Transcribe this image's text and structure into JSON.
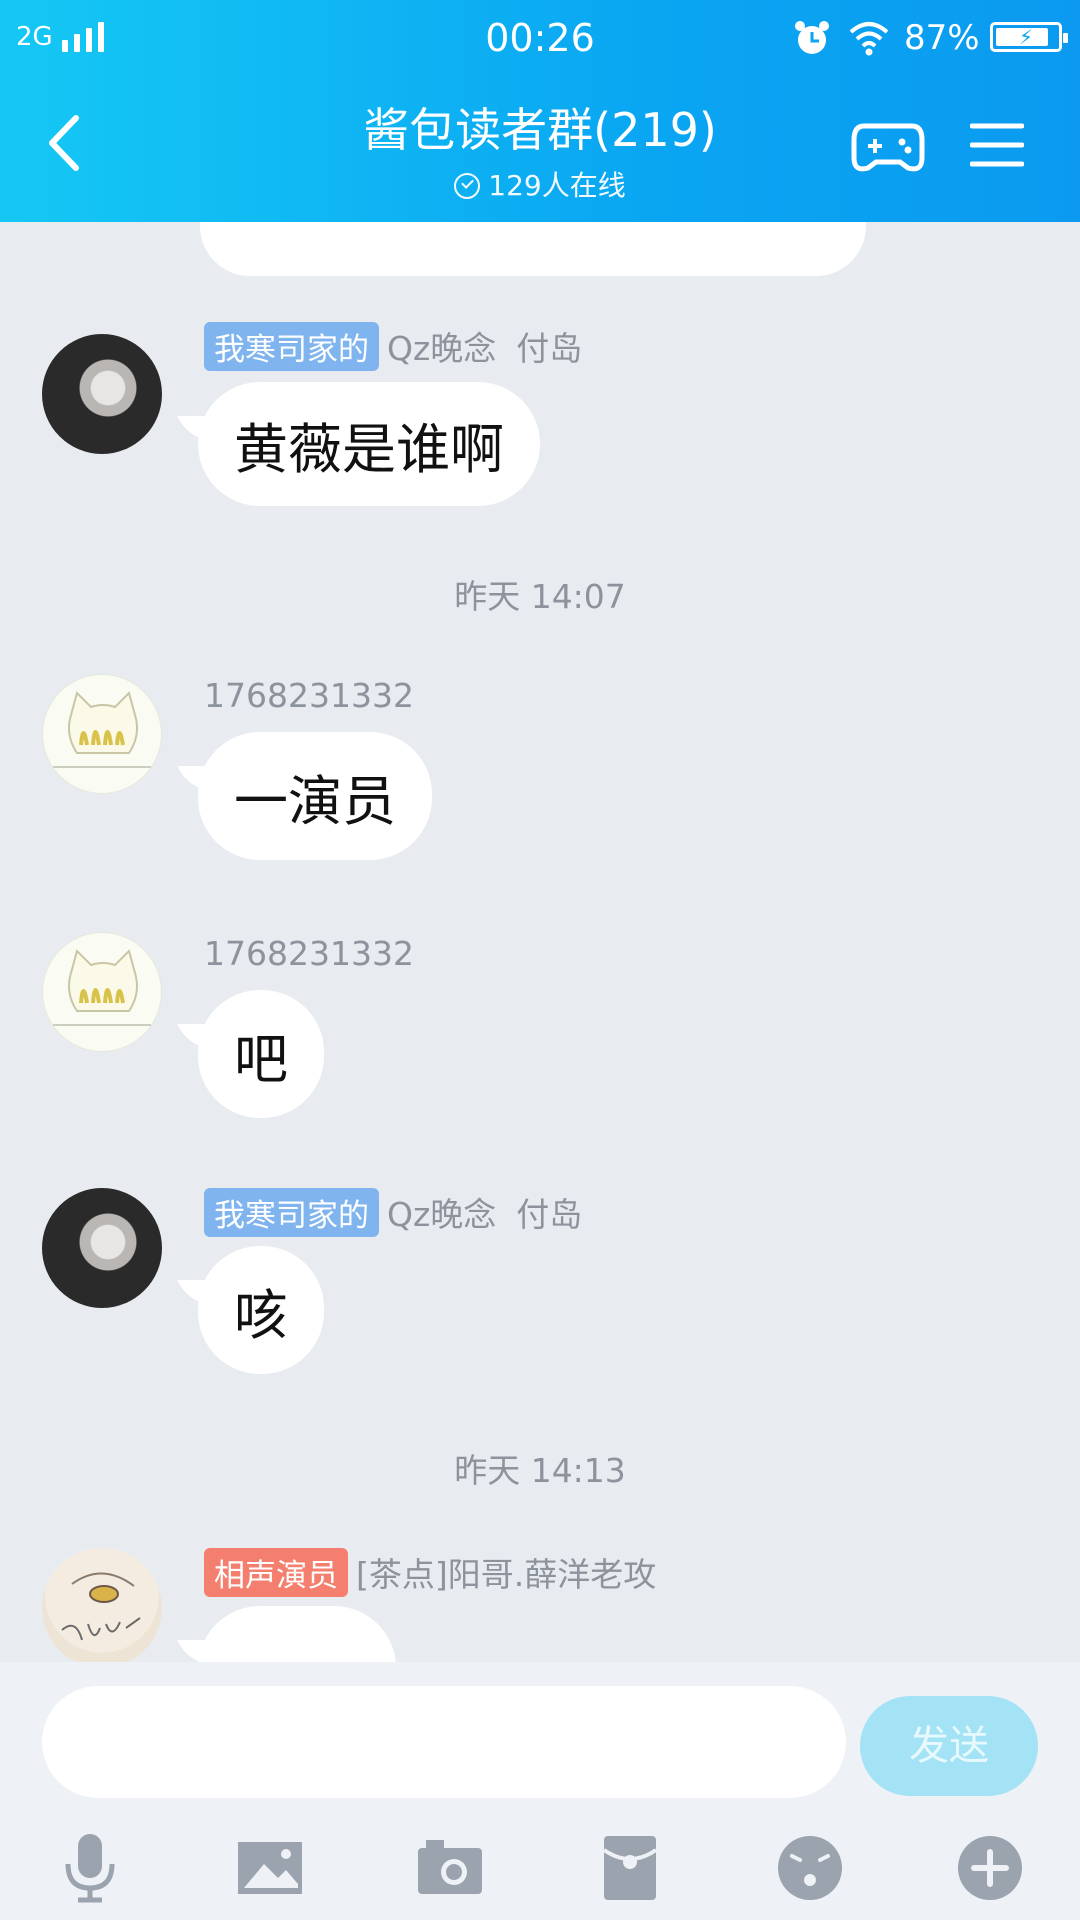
{
  "status_bar": {
    "network": "2G",
    "time": "00:26",
    "battery": "87%",
    "battery_level": 0.87
  },
  "header": {
    "title": "酱包读者群(219)",
    "online": "129人在线"
  },
  "messages": [
    {
      "type": "text",
      "tag": "我寒司家的",
      "tag_color": "#7fb4ef",
      "name": "Qz晚念",
      "name2": "付岛",
      "text": "黄薇是谁啊",
      "avatar": "dark-photo-avatar"
    },
    {
      "type": "time",
      "text": "昨天 14:07"
    },
    {
      "type": "text",
      "name": "1768231332",
      "text": "一演员",
      "avatar": "cat-avatar"
    },
    {
      "type": "text",
      "name": "1768231332",
      "text": "吧",
      "avatar": "cat-avatar"
    },
    {
      "type": "text",
      "tag": "我寒司家的",
      "tag_color": "#7fb4ef",
      "name": "Qz晚念",
      "name2": "付岛",
      "text": "咳",
      "avatar": "dark-photo-avatar"
    },
    {
      "type": "time",
      "text": "昨天 14:13"
    },
    {
      "type": "text",
      "tag": "相声演员",
      "tag_color": "#f47f6e",
      "name": "[茶点]阳哥.薛洋老攻",
      "text": "",
      "avatar": "egypt-avatar"
    }
  ],
  "input": {
    "value": "",
    "send_label": "发送"
  },
  "toolbar": [
    "microphone-icon",
    "image-icon",
    "camera-icon",
    "red-packet-icon",
    "emoji-icon",
    "plus-icon"
  ],
  "colors": {
    "header_gradient_start": "#15c8f4",
    "header_gradient_end": "#0b9af0",
    "chat_bg": "#e8ecf1",
    "send_button": "#a4e3f5",
    "toolbar_icon": "#9aa3ae"
  }
}
